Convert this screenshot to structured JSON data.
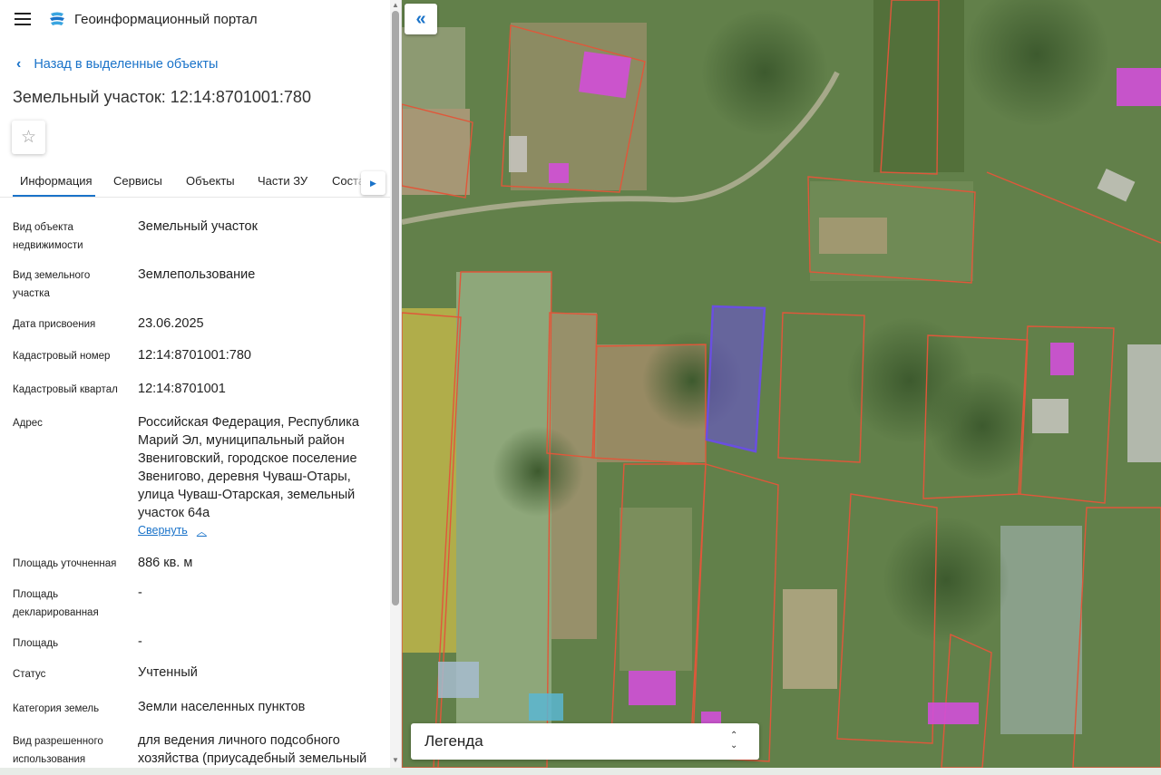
{
  "app": {
    "title": "Геоинформационный портал"
  },
  "nav": {
    "back_label": "Назад в выделенные объекты"
  },
  "object": {
    "title": "Земельный участок: 12:14:8701001:780"
  },
  "tabs": [
    {
      "label": "Информация"
    },
    {
      "label": "Сервисы"
    },
    {
      "label": "Объекты"
    },
    {
      "label": "Части ЗУ"
    },
    {
      "label": "Соста"
    }
  ],
  "properties": [
    {
      "label": "Вид объекта недвижимости",
      "value": "Земельный участок"
    },
    {
      "label": "Вид земельного участка",
      "value": "Землепользование"
    },
    {
      "label": "Дата присвоения",
      "value": "23.06.2025"
    },
    {
      "label": "Кадастровый номер",
      "value": "12:14:8701001:780"
    },
    {
      "label": "Кадастровый квартал",
      "value": "12:14:8701001"
    },
    {
      "label": "Адрес",
      "value": "Российская Федерация, Республика Марий Эл, муниципальный район Звениговский, городское поселение Звенигово, деревня Чуваш-Отары, улица Чуваш-Отарская, земельный участок 64а"
    },
    {
      "label": "Площадь уточненная",
      "value": "886 кв. м"
    },
    {
      "label": "Площадь декларированная",
      "value": "-"
    },
    {
      "label": "Площадь",
      "value": "-"
    },
    {
      "label": "Статус",
      "value": "Учтенный"
    },
    {
      "label": "Категория земель",
      "value": "Земли населенных пунктов"
    },
    {
      "label": "Вид разрешенного использования",
      "value": "для ведения личного подсобного хозяйства (приусадебный земельный"
    }
  ],
  "address_toggle": {
    "label": "Свернуть"
  },
  "map": {
    "legend_label": "Легенда",
    "selected_parcel_color": "#6a4fe0",
    "parcel_border_color": "#e0573a",
    "building_color": "#d24fd8"
  },
  "icons": {
    "menu": "hamburger-icon",
    "back": "chevron-left-icon",
    "favorite": "star-icon",
    "collapse_panel": "double-chevron-left-icon",
    "tab_scroll": "chevron-right-icon"
  }
}
